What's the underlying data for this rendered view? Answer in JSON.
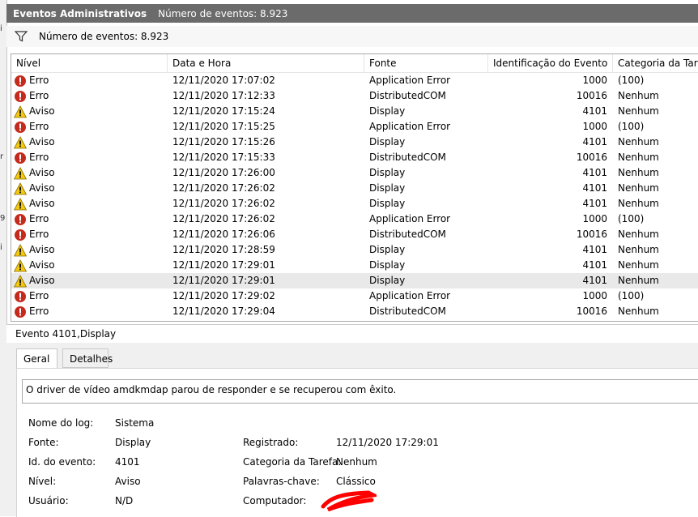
{
  "window": {
    "title": "Eventos Administrativos",
    "event_count": "Número de eventos: 8.923"
  },
  "filterbar": {
    "icon": "funnel-icon",
    "count_label": "Número de eventos: 8.923"
  },
  "columns": {
    "level": "Nível",
    "date": "Data e Hora",
    "source": "Fonte",
    "event_id": "Identificação do Evento",
    "category": "Categoria da Tarefa"
  },
  "rows": [
    {
      "type": "error",
      "level": "Erro",
      "date": "12/11/2020 17:07:02",
      "source": "Application Error",
      "id": "1000",
      "category": "(100)"
    },
    {
      "type": "error",
      "level": "Erro",
      "date": "12/11/2020 17:12:33",
      "source": "DistributedCOM",
      "id": "10016",
      "category": "Nenhum"
    },
    {
      "type": "warning",
      "level": "Aviso",
      "date": "12/11/2020 17:15:24",
      "source": "Display",
      "id": "4101",
      "category": "Nenhum"
    },
    {
      "type": "error",
      "level": "Erro",
      "date": "12/11/2020 17:15:25",
      "source": "Application Error",
      "id": "1000",
      "category": "(100)"
    },
    {
      "type": "warning",
      "level": "Aviso",
      "date": "12/11/2020 17:15:26",
      "source": "Display",
      "id": "4101",
      "category": "Nenhum"
    },
    {
      "type": "error",
      "level": "Erro",
      "date": "12/11/2020 17:15:33",
      "source": "DistributedCOM",
      "id": "10016",
      "category": "Nenhum"
    },
    {
      "type": "warning",
      "level": "Aviso",
      "date": "12/11/2020 17:26:00",
      "source": "Display",
      "id": "4101",
      "category": "Nenhum"
    },
    {
      "type": "warning",
      "level": "Aviso",
      "date": "12/11/2020 17:26:02",
      "source": "Display",
      "id": "4101",
      "category": "Nenhum"
    },
    {
      "type": "warning",
      "level": "Aviso",
      "date": "12/11/2020 17:26:02",
      "source": "Display",
      "id": "4101",
      "category": "Nenhum"
    },
    {
      "type": "error",
      "level": "Erro",
      "date": "12/11/2020 17:26:02",
      "source": "Application Error",
      "id": "1000",
      "category": "(100)"
    },
    {
      "type": "error",
      "level": "Erro",
      "date": "12/11/2020 17:26:06",
      "source": "DistributedCOM",
      "id": "10016",
      "category": "Nenhum"
    },
    {
      "type": "warning",
      "level": "Aviso",
      "date": "12/11/2020 17:28:59",
      "source": "Display",
      "id": "4101",
      "category": "Nenhum"
    },
    {
      "type": "warning",
      "level": "Aviso",
      "date": "12/11/2020 17:29:01",
      "source": "Display",
      "id": "4101",
      "category": "Nenhum"
    },
    {
      "type": "warning",
      "level": "Aviso",
      "date": "12/11/2020 17:29:01",
      "source": "Display",
      "id": "4101",
      "category": "Nenhum",
      "selected": true
    },
    {
      "type": "error",
      "level": "Erro",
      "date": "12/11/2020 17:29:02",
      "source": "Application Error",
      "id": "1000",
      "category": "(100)"
    },
    {
      "type": "error",
      "level": "Erro",
      "date": "12/11/2020 17:29:04",
      "source": "DistributedCOM",
      "id": "10016",
      "category": "Nenhum"
    }
  ],
  "details": {
    "header": "Evento 4101,Display",
    "tabs": [
      "Geral",
      "Detalhes"
    ],
    "description": "O driver de vídeo amdkmdap parou de responder e se recuperou com êxito.",
    "log_name_label": "Nome do log:",
    "log_name_value": "Sistema",
    "source_label": "Fonte:",
    "source_value": "Display",
    "logged_label": "Registrado:",
    "logged_value": "12/11/2020 17:29:01",
    "event_id_label": "Id. do evento:",
    "event_id_value": "4101",
    "task_category_label": "Categoria da Tarefa:",
    "task_category_value": "Nenhum",
    "level_label": "Nível:",
    "level_value": "Aviso",
    "keywords_label": "Palavras-chave:",
    "keywords_value": "Clássico",
    "user_label": "Usuário:",
    "user_value": "N/D",
    "computer_label": "Computador:"
  },
  "colors": {
    "error": "#c42b1c",
    "warning": "#f2c811",
    "titlebar": "#6b6b6b",
    "redaction": "#ff0000"
  }
}
